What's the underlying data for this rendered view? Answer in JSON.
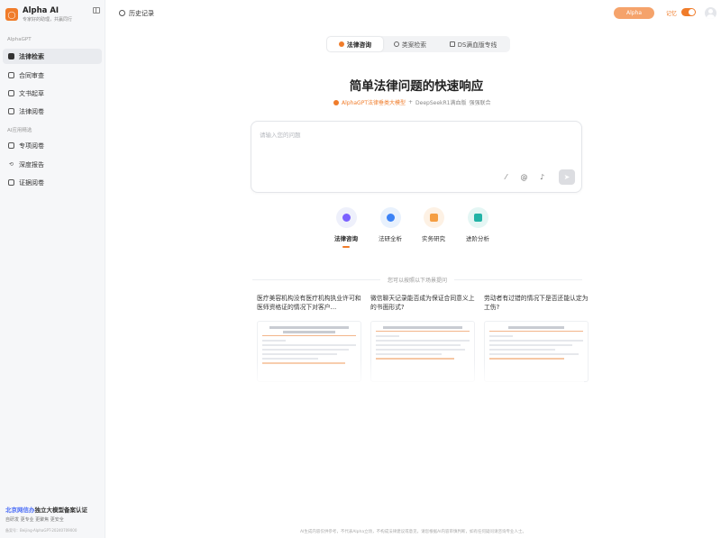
{
  "sidebar": {
    "brand_name": "Alpha AI",
    "brand_slogan": "专家好的助理，共赢同行",
    "group1_label": "AlphaGPT",
    "group1_items": [
      {
        "label": "法律检索",
        "icon": "grid-icon",
        "active": true
      },
      {
        "label": "合同审查",
        "icon": "contract-icon",
        "active": false
      },
      {
        "label": "文书起草",
        "icon": "document-icon",
        "active": false
      },
      {
        "label": "法律阅卷",
        "icon": "folder-icon",
        "active": false
      }
    ],
    "group2_label": "AI应用精选",
    "group2_items": [
      {
        "label": "专项阅卷",
        "icon": "file-icon"
      },
      {
        "label": "深度报告",
        "icon": "report-icon"
      },
      {
        "label": "证据阅卷",
        "icon": "evidence-icon"
      }
    ],
    "promo_prefix": "北京网信办",
    "promo_title_rest": "独立大模型备案认证",
    "promo_sub": "自研发  更专业  更聚焦  更安全",
    "promo_reg": "备案号：Beijing-AlphaGPT-20240709000"
  },
  "topbar": {
    "history_label": "历史记录",
    "alpha_label": "Alpha",
    "memory_label": "记忆",
    "memory_on": true
  },
  "mode_tabs": [
    {
      "label": "法律咨询",
      "active": true
    },
    {
      "label": "类案检索",
      "active": false
    },
    {
      "label": "DS满血版专线",
      "active": false
    }
  ],
  "main": {
    "title": "简单法律问题的快速响应",
    "model_primary": "AlphaGPT法律垂类大模型",
    "model_plus": "+",
    "model_secondary": "DeepSeekR1满血版",
    "model_suffix": "强强联合",
    "input_placeholder": "请输入您的问题"
  },
  "features": [
    {
      "label": "法律咨询",
      "color": "#7b61ff",
      "bg": "#eef0fb",
      "active": true
    },
    {
      "label": "法研全析",
      "color": "#3b82f6",
      "bg": "#e8f1fd",
      "active": false
    },
    {
      "label": "实务研究",
      "color": "#f59e42",
      "bg": "#fdf1e4",
      "active": false
    },
    {
      "label": "进阶分析",
      "color": "#22b3a6",
      "bg": "#e4f6f4",
      "active": false
    }
  ],
  "suggest_hint": "您可以按照以下场景提问",
  "cards": [
    {
      "question": "医疗美容机构没有医疗机构执业许可和医师资格证的情况下对客户…"
    },
    {
      "question": "微信聊天记录能否成为保证合同意义上的书面形式?"
    },
    {
      "question": "劳动者有过错的情况下是否还能认定为工伤?"
    }
  ],
  "footer": "AI生成内容仅供参考，不代表Alpha立场，不构成法律建议或意见，请您根据AI内容审慎判断，如有任何疑问请咨询专业人士。"
}
